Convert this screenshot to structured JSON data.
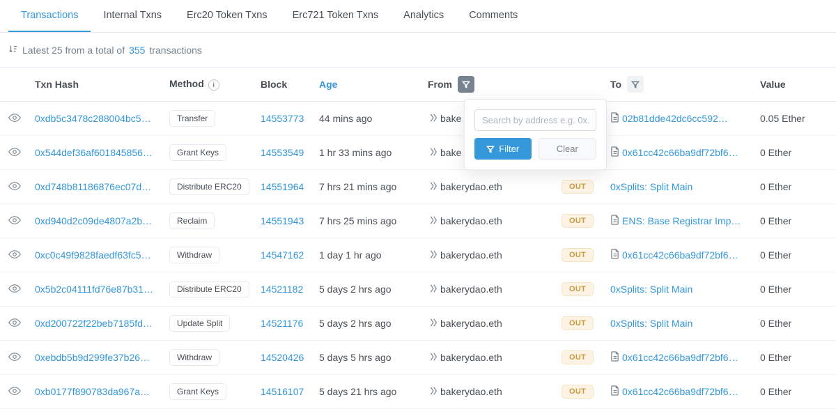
{
  "tabs": [
    {
      "label": "Transactions",
      "active": true
    },
    {
      "label": "Internal Txns",
      "active": false
    },
    {
      "label": "Erc20 Token Txns",
      "active": false
    },
    {
      "label": "Erc721 Token Txns",
      "active": false
    },
    {
      "label": "Analytics",
      "active": false
    },
    {
      "label": "Comments",
      "active": false
    }
  ],
  "summary": {
    "prefix": "Latest 25 from a total of",
    "count": "355",
    "suffix": "transactions"
  },
  "headers": {
    "hash": "Txn Hash",
    "method": "Method",
    "block": "Block",
    "age": "Age",
    "from": "From",
    "to": "To",
    "value": "Value"
  },
  "popover": {
    "placeholder": "Search by address e.g. 0x..",
    "filter_label": "Filter",
    "clear_label": "Clear"
  },
  "rows": [
    {
      "hash": "0xdb5c3478c288004bc5…",
      "method": "Transfer",
      "block": "14553773",
      "age": "44 mins ago",
      "from": "bake",
      "dir": "",
      "to_icon": "doc",
      "to": "02b81dde42dc6cc592…",
      "value": "0.05 Ether"
    },
    {
      "hash": "0x544def36af601845856…",
      "method": "Grant Keys",
      "block": "14553549",
      "age": "1 hr 33 mins ago",
      "from": "bake",
      "dir": "",
      "to_icon": "doc",
      "to": "0x61cc42c66ba9df72bf6…",
      "value": "0 Ether"
    },
    {
      "hash": "0xd748b81186876ec07d…",
      "method": "Distribute ERC20",
      "block": "14551964",
      "age": "7 hrs 21 mins ago",
      "from": "bakerydao.eth",
      "dir": "OUT",
      "to_icon": "",
      "to": "0xSplits: Split Main",
      "value": "0 Ether"
    },
    {
      "hash": "0xd940d2c09de4807a2b…",
      "method": "Reclaim",
      "block": "14551943",
      "age": "7 hrs 25 mins ago",
      "from": "bakerydao.eth",
      "dir": "OUT",
      "to_icon": "doc",
      "to": "ENS: Base Registrar Imp…",
      "value": "0 Ether"
    },
    {
      "hash": "0xc0c49f9828faedf63fc5…",
      "method": "Withdraw",
      "block": "14547162",
      "age": "1 day 1 hr ago",
      "from": "bakerydao.eth",
      "dir": "OUT",
      "to_icon": "doc",
      "to": "0x61cc42c66ba9df72bf6…",
      "value": "0 Ether"
    },
    {
      "hash": "0x5b2c04111fd76e87b31…",
      "method": "Distribute ERC20",
      "block": "14521182",
      "age": "5 days 2 hrs ago",
      "from": "bakerydao.eth",
      "dir": "OUT",
      "to_icon": "",
      "to": "0xSplits: Split Main",
      "value": "0 Ether"
    },
    {
      "hash": "0xd200722f22beb7185fd…",
      "method": "Update Split",
      "block": "14521176",
      "age": "5 days 2 hrs ago",
      "from": "bakerydao.eth",
      "dir": "OUT",
      "to_icon": "",
      "to": "0xSplits: Split Main",
      "value": "0 Ether"
    },
    {
      "hash": "0xebdb5b9d299fe37b26…",
      "method": "Withdraw",
      "block": "14520426",
      "age": "5 days 5 hrs ago",
      "from": "bakerydao.eth",
      "dir": "OUT",
      "to_icon": "doc",
      "to": "0x61cc42c66ba9df72bf6…",
      "value": "0 Ether"
    },
    {
      "hash": "0xb0177f890783da967a…",
      "method": "Grant Keys",
      "block": "14516107",
      "age": "5 days 21 hrs ago",
      "from": "bakerydao.eth",
      "dir": "OUT",
      "to_icon": "doc",
      "to": "0x61cc42c66ba9df72bf6…",
      "value": "0 Ether"
    }
  ]
}
